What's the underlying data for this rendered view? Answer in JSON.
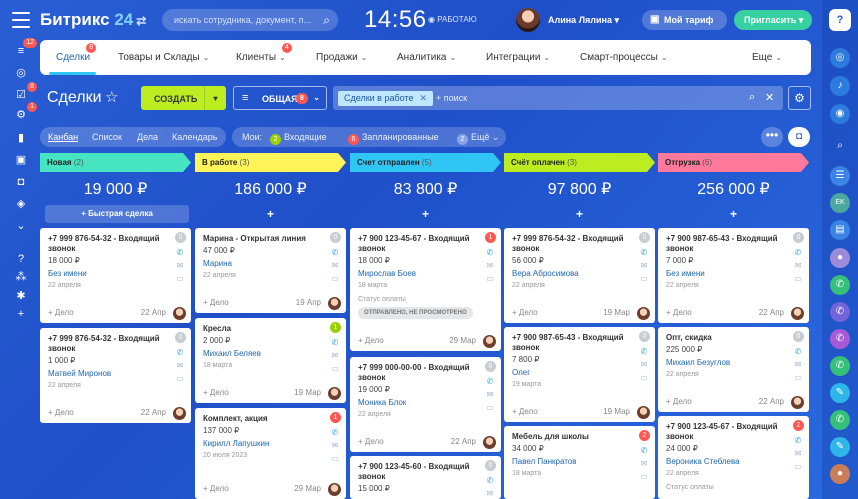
{
  "app": {
    "logo_name": "Битрикс",
    "logo_num": "24",
    "search_placeholder": "искать сотрудника, документ, п...",
    "time": "14:56",
    "work_status": "◉ РАБОТАЮ",
    "user_name": "Алина Лялина",
    "tariff_label": "Мой тариф",
    "invite_label": "Пригласить"
  },
  "left_badges": {
    "filter": "12",
    "tasks": "8",
    "activity": "1"
  },
  "tabs": [
    {
      "label": "Сделки",
      "badge": "8"
    },
    {
      "label": "Товары и Склады",
      "badge": ""
    },
    {
      "label": "Клиенты",
      "badge": "4"
    },
    {
      "label": "Продажи",
      "badge": ""
    },
    {
      "label": "Аналитика",
      "badge": ""
    },
    {
      "label": "Интеграции",
      "badge": ""
    },
    {
      "label": "Смарт-процессы",
      "badge": ""
    },
    {
      "label": "Еще",
      "badge": ""
    }
  ],
  "toolbar": {
    "title": "Сделки",
    "create_label": "СОЗДАТЬ",
    "filter_label": "ОБЩАЯ",
    "filter_badge": "8",
    "chip_label": "Сделки в работе",
    "search_placeholder": "+ поиск"
  },
  "views": [
    "Канбан",
    "Список",
    "Дела",
    "Календарь"
  ],
  "counters": {
    "label": "Мои:",
    "incoming": {
      "count": "2",
      "label": "Входящие"
    },
    "scheduled": {
      "count": "6",
      "label": "Запланированные"
    },
    "more": {
      "count": "2",
      "label": "Ещё"
    }
  },
  "columns": [
    {
      "title": "Новая",
      "count": "(2)",
      "color": "#47e4c2",
      "sum": "19 000 ₽",
      "add_label": "+ Быстрая сделка",
      "cards": [
        {
          "title": "+7 999 876-54-32 - Входящий звонок",
          "badge": "0",
          "badge_color": "#c7ccd1",
          "amount": "18 000 ₽",
          "client": "Без имени",
          "date": "22 апреля",
          "status_label": "",
          "status": "",
          "footer": "+ Дело",
          "footer_date": "22 Апр"
        },
        {
          "title": "+7 999 876-54-32 - Входящий звонок",
          "badge": "0",
          "badge_color": "#c7ccd1",
          "amount": "1 000 ₽",
          "client": "Матвей Миронов",
          "date": "22 апреля",
          "status_label": "",
          "status": "",
          "footer": "+ Дело",
          "footer_date": "22 Апр"
        }
      ]
    },
    {
      "title": "В работе",
      "count": "(3)",
      "color": "#fff55a",
      "sum": "186 000 ₽",
      "add_label": "+",
      "cards": [
        {
          "title": "Марина - Открытая линия",
          "badge": "0",
          "badge_color": "#c7ccd1",
          "amount": "47 000 ₽",
          "client": "Марина",
          "date": "22 апреля",
          "status_label": "",
          "status": "",
          "footer": "+ Дело",
          "footer_date": "19 Апр"
        },
        {
          "title": "Кресла",
          "badge": "1",
          "badge_color": "#9dcf00",
          "amount": "2 000 ₽",
          "client": "Михаил Беляев",
          "date": "18 марта",
          "status_label": "",
          "status": "",
          "footer": "+ Дело",
          "footer_date": "19 Мар"
        },
        {
          "title": "Комплект, акция",
          "badge": "1",
          "badge_color": "#ff5752",
          "amount": "137 000 ₽",
          "client": "Кирилл Лапушкин",
          "date": "20 июля 2023",
          "status_label": "",
          "status": "",
          "footer": "+ Дело",
          "footer_date": "29 Мар"
        }
      ]
    },
    {
      "title": "Счет отправлен",
      "count": "(5)",
      "color": "#2fc6f6",
      "sum": "83 800 ₽",
      "add_label": "+",
      "cards": [
        {
          "title": "+7 900 123-45-67 - Входящий звонок",
          "badge": "1",
          "badge_color": "#ff5752",
          "amount": "18 000 ₽",
          "client": "Мирослав Боев",
          "date": "18 марта",
          "status_label": "Статус оплаты",
          "status": "ОТПРАВЛЕНО, НЕ ПРОСМОТРЕНО",
          "footer": "+ Дело",
          "footer_date": "29 Мар"
        },
        {
          "title": "+7 999 000-00-00 - Входящий звонок",
          "badge": "0",
          "badge_color": "#c7ccd1",
          "amount": "19 000 ₽",
          "client": "Моника Блок",
          "date": "22 апреля",
          "status_label": "",
          "status": "",
          "footer": "+ Дело",
          "footer_date": "22 Апр"
        },
        {
          "title": "+7 900 123-45-60 - Входящий звонок",
          "badge": "0",
          "badge_color": "#c7ccd1",
          "amount": "15 000 ₽",
          "client": "",
          "date": "",
          "status_label": "",
          "status": "",
          "footer": "",
          "footer_date": ""
        }
      ]
    },
    {
      "title": "Счёт оплачен",
      "count": "(3)",
      "color": "#bbed21",
      "sum": "97 800 ₽",
      "add_label": "+",
      "cards": [
        {
          "title": "+7 999 876-54-32 - Входящий звонок",
          "badge": "0",
          "badge_color": "#c7ccd1",
          "amount": "56 000 ₽",
          "client": "Вера Абросимова",
          "date": "22 апреля",
          "status_label": "",
          "status": "",
          "footer": "+ Дело",
          "footer_date": "19 Мар"
        },
        {
          "title": "+7 900 987-65-43 - Входящий звонок",
          "badge": "0",
          "badge_color": "#c7ccd1",
          "amount": "7 800 ₽",
          "client": "Олег",
          "date": "19 марта",
          "status_label": "",
          "status": "",
          "footer": "+ Дело",
          "footer_date": "19 Мар"
        },
        {
          "title": "Мебель для школы",
          "badge": "2",
          "badge_color": "#ff5752",
          "amount": "34 000 ₽",
          "client": "Павел Панкратов",
          "date": "18 марта",
          "status_label": "",
          "status": "",
          "footer": "",
          "footer_date": ""
        }
      ]
    },
    {
      "title": "Отгрузка",
      "count": "(6)",
      "color": "#ff799c",
      "sum": "256 000 ₽",
      "add_label": "+",
      "cards": [
        {
          "title": "+7 900 987-65-43 - Входящий звонок",
          "badge": "0",
          "badge_color": "#c7ccd1",
          "amount": "7 000 ₽",
          "client": "Без имени",
          "date": "22 апреля",
          "status_label": "",
          "status": "",
          "footer": "+ Дело",
          "footer_date": "22 Апр"
        },
        {
          "title": "Опт, скидка",
          "badge": "0",
          "badge_color": "#c7ccd1",
          "amount": "225 000 ₽",
          "client": "Михаил Безуглов",
          "date": "22 апреля",
          "status_label": "",
          "status": "",
          "footer": "+ Дело",
          "footer_date": "22 Апр"
        },
        {
          "title": "+7 900 123-45-67 - Входящий звонок",
          "badge": "2",
          "badge_color": "#ff5752",
          "amount": "24 000 ₽",
          "client": "Вероника Стеблева",
          "date": "22 апреля",
          "status_label": "Статус оплаты",
          "status": "",
          "footer": "",
          "footer_date": ""
        }
      ]
    }
  ]
}
